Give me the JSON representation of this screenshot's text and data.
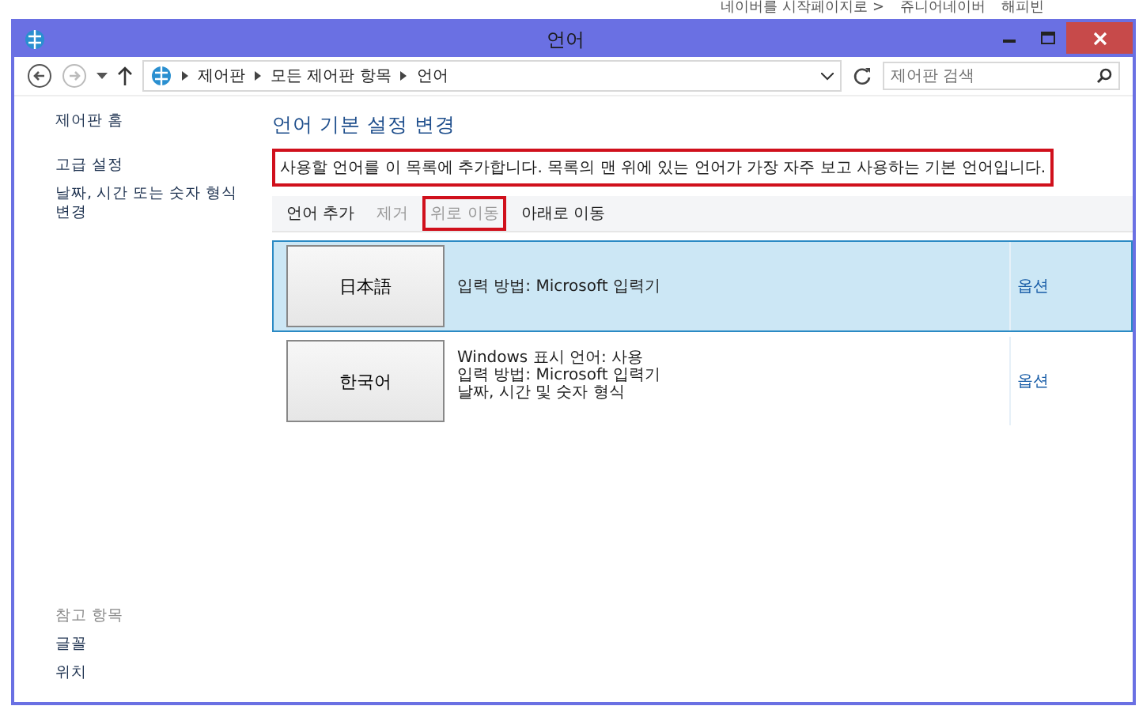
{
  "background_links": [
    "네이버를 시작페이지로 >",
    "쥬니어네이버",
    "해피빈"
  ],
  "window": {
    "title": "언어"
  },
  "address_bar": {
    "path": [
      "제어판",
      "모든 제어판 항목",
      "언어"
    ],
    "search": {
      "placeholder": "제어판 검색"
    }
  },
  "sidebar": {
    "items": [
      {
        "label": "제어판 홈"
      },
      {
        "label": "고급 설정"
      },
      {
        "label": "날짜, 시간 또는 숫자 형식 변경"
      }
    ],
    "see_also": {
      "heading": "참고 항목",
      "items": [
        {
          "label": "글꼴"
        },
        {
          "label": "위치"
        }
      ]
    }
  },
  "main": {
    "title": "언어 기본 설정 변경",
    "description": {
      "text": "사용할 언어를 이 목록에 추가합니다. 목록의 맨 위에 있는 언어가 가장 자주 보고 사용하는 기본 언어입니다.",
      "highlighted": true
    },
    "toolbar": [
      {
        "label": "언어 추가",
        "disabled": false,
        "highlighted": false
      },
      {
        "label": "제거",
        "disabled": true,
        "highlighted": false
      },
      {
        "label": "위로 이동",
        "disabled": true,
        "highlighted": true
      },
      {
        "label": "아래로 이동",
        "disabled": false,
        "highlighted": false
      }
    ],
    "languages": [
      {
        "name": "日本語",
        "selected": true,
        "details": [
          "입력 방법: Microsoft 입력기"
        ],
        "options": "옵션"
      },
      {
        "name": "한국어",
        "selected": false,
        "details": [
          "Windows 표시 언어: 사용",
          "입력 방법: Microsoft 입력기",
          "날짜, 시간 및 숫자 형식"
        ],
        "options": "옵션"
      }
    ]
  }
}
